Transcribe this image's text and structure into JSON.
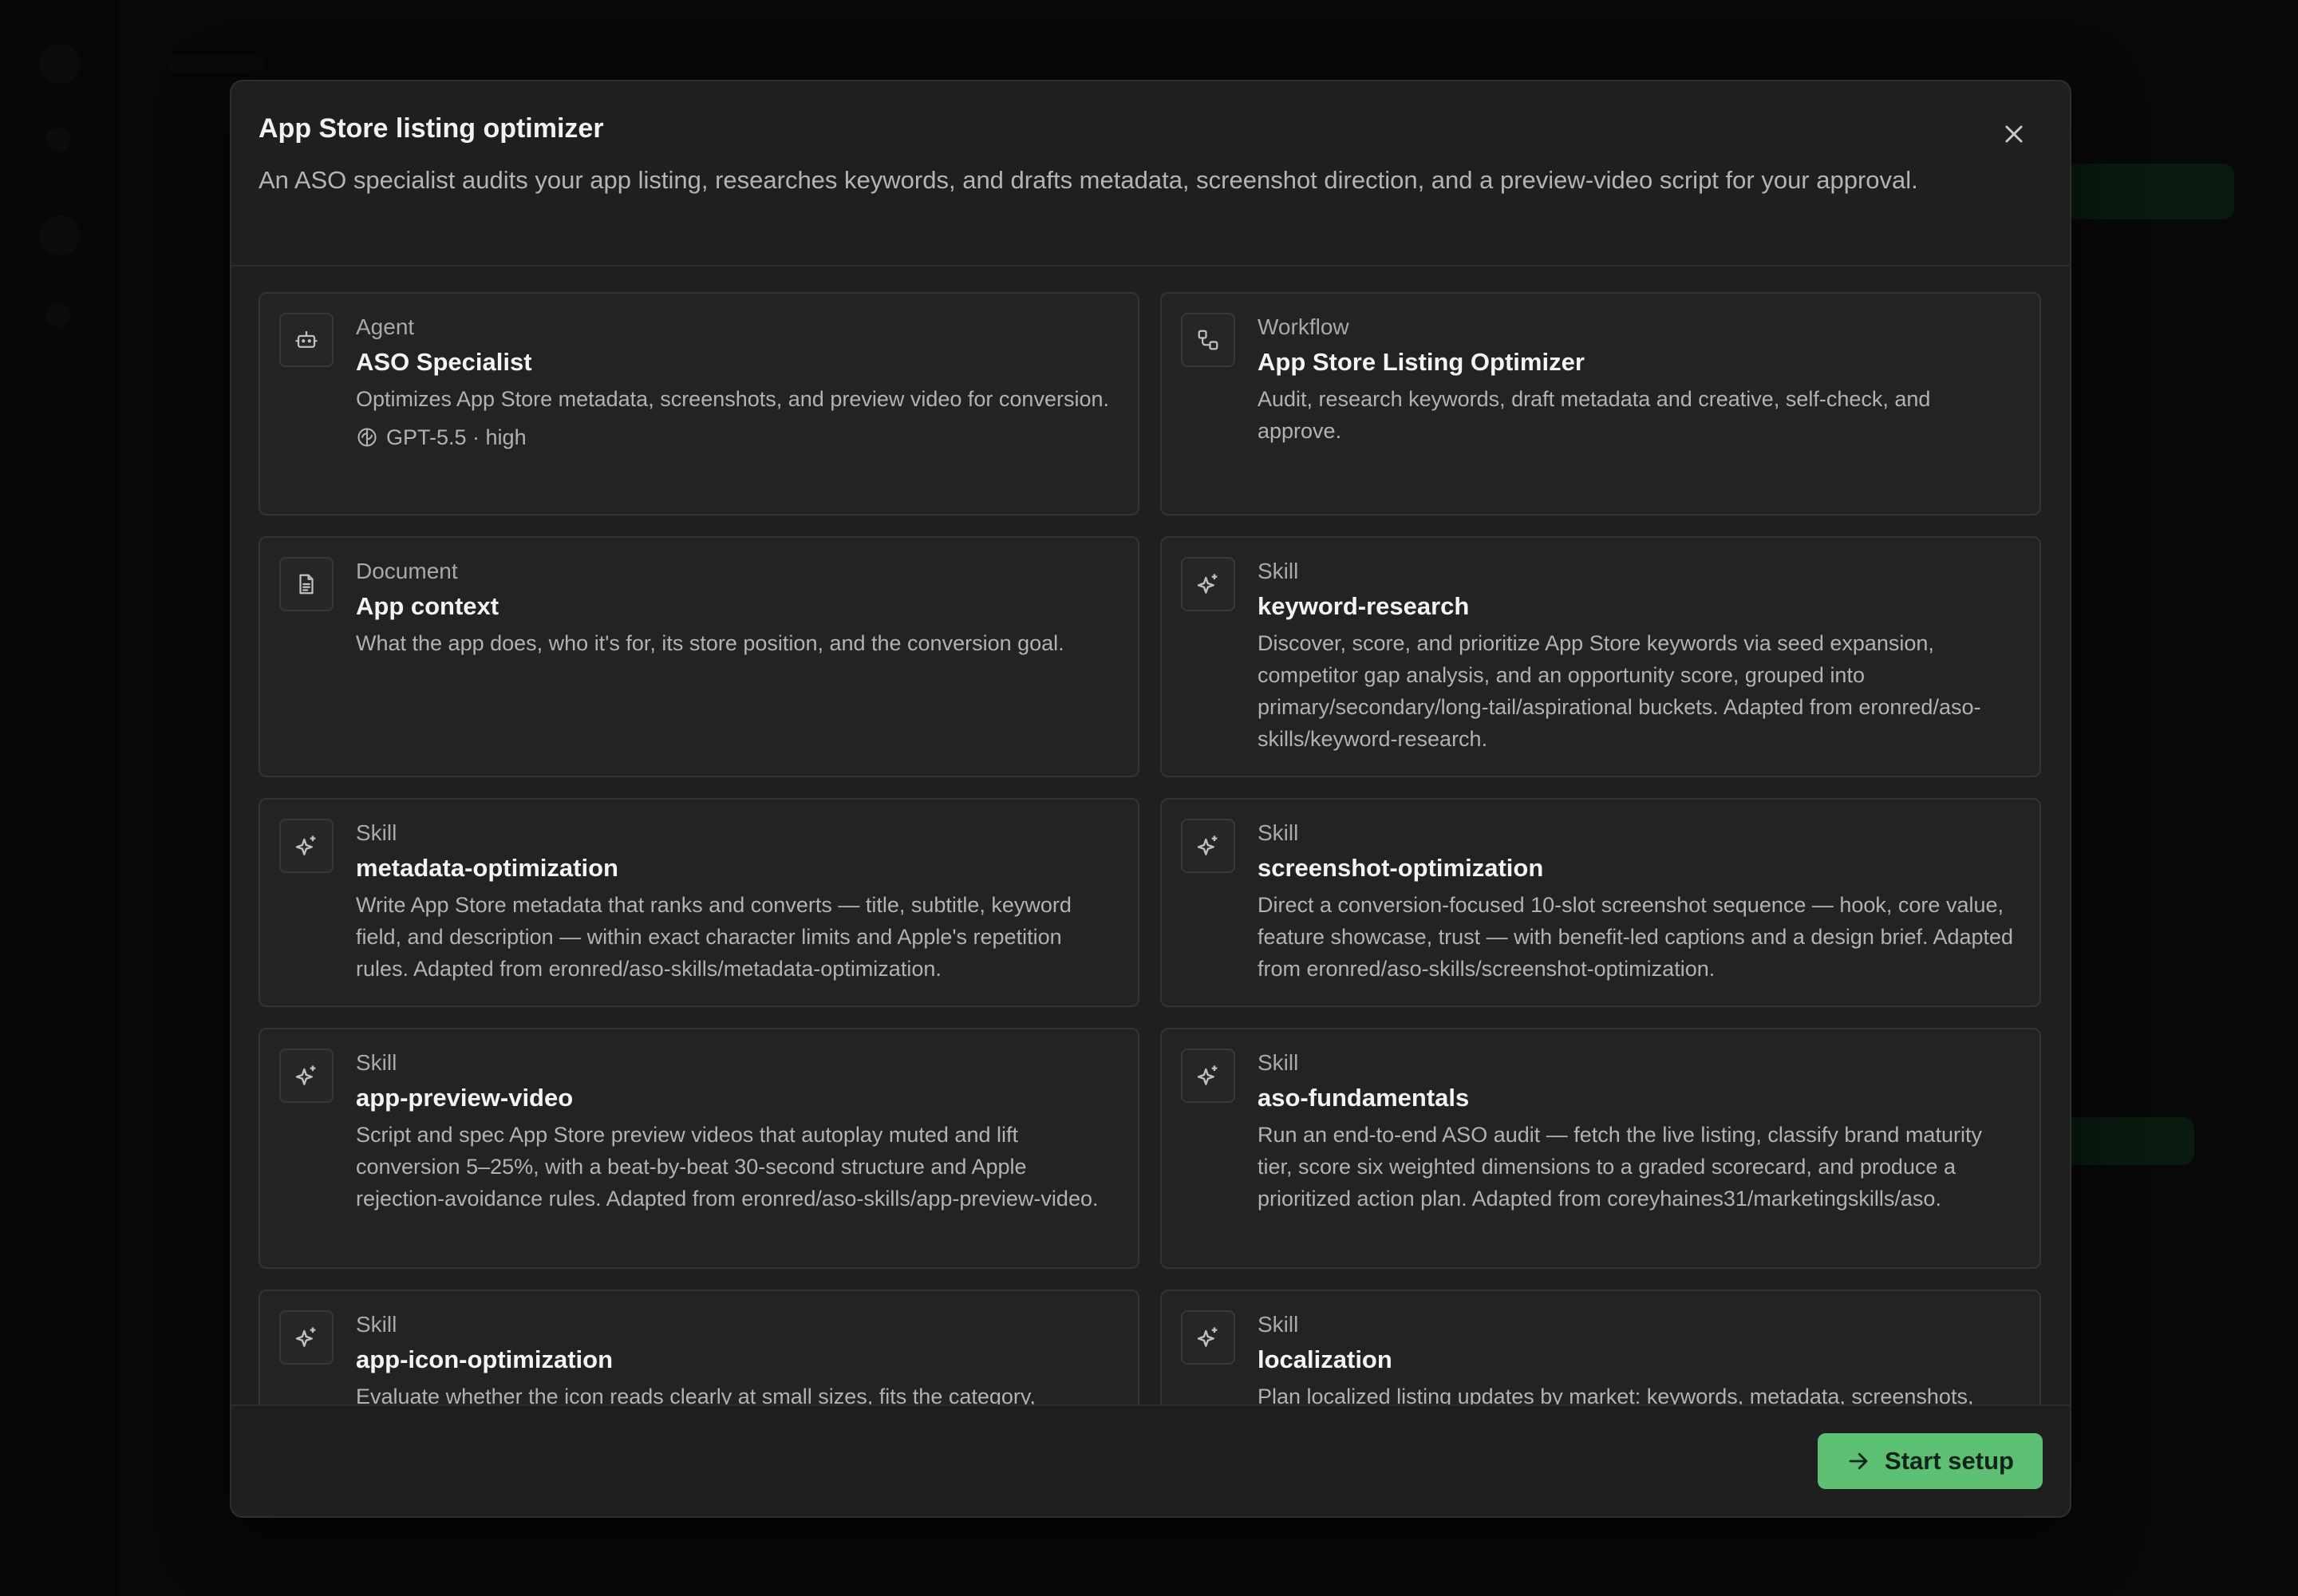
{
  "modal": {
    "title": "App Store listing optimizer",
    "description": "An ASO specialist audits your app listing, researches keywords, and drafts metadata, screenshot direction, and a preview-video script for your approval.",
    "close_icon": "close-icon",
    "cards": [
      {
        "type": "Agent",
        "name": "ASO Specialist",
        "icon": "robot-icon",
        "description": "Optimizes App Store metadata, screenshots, and preview video for conversion.",
        "meta": "GPT-5.5 · high",
        "meta_icon": "model-icon"
      },
      {
        "type": "Workflow",
        "name": "App Store Listing Optimizer",
        "icon": "workflow-icon",
        "description": "Audit, research keywords, draft metadata and creative, self-check, and approve."
      },
      {
        "type": "Document",
        "name": "App context",
        "icon": "document-icon",
        "description": "What the app does, who it's for, its store position, and the conversion goal."
      },
      {
        "type": "Skill",
        "name": "keyword-research",
        "icon": "sparkle-icon",
        "description": "Discover, score, and prioritize App Store keywords via seed expansion, competitor gap analysis, and an opportunity score, grouped into primary/secondary/long-tail/aspirational buckets. Adapted from eronred/aso-skills/keyword-research."
      },
      {
        "type": "Skill",
        "name": "metadata-optimization",
        "icon": "sparkle-icon",
        "description": "Write App Store metadata that ranks and converts — title, subtitle, keyword field, and description — within exact character limits and Apple's repetition rules. Adapted from eronred/aso-skills/metadata-optimization."
      },
      {
        "type": "Skill",
        "name": "screenshot-optimization",
        "icon": "sparkle-icon",
        "description": "Direct a conversion-focused 10-slot screenshot sequence — hook, core value, feature showcase, trust — with benefit-led captions and a design brief. Adapted from eronred/aso-skills/screenshot-optimization."
      },
      {
        "type": "Skill",
        "name": "app-preview-video",
        "icon": "sparkle-icon",
        "description": "Script and spec App Store preview videos that autoplay muted and lift conversion 5–25%, with a beat-by-beat 30-second structure and Apple rejection-avoidance rules. Adapted from eronred/aso-skills/app-preview-video."
      },
      {
        "type": "Skill",
        "name": "aso-fundamentals",
        "icon": "sparkle-icon",
        "description": "Run an end-to-end ASO audit — fetch the live listing, classify brand maturity tier, score six weighted dimensions to a graded scorecard, and produce a prioritized action plan. Adapted from coreyhaines31/marketingskills/aso."
      },
      {
        "type": "Skill",
        "name": "app-icon-optimization",
        "icon": "sparkle-icon",
        "description": "Evaluate whether the icon reads clearly at small sizes, fits the category,"
      },
      {
        "type": "Skill",
        "name": "localization",
        "icon": "sparkle-icon",
        "description": "Plan localized listing updates by market: keywords, metadata, screenshots,"
      }
    ],
    "start_button": {
      "label": "Start setup",
      "icon": "arrow-right-icon"
    }
  },
  "colors": {
    "accent": "#5cbf74",
    "modal_bg": "#1f1f1f",
    "card_bg": "#232323"
  }
}
